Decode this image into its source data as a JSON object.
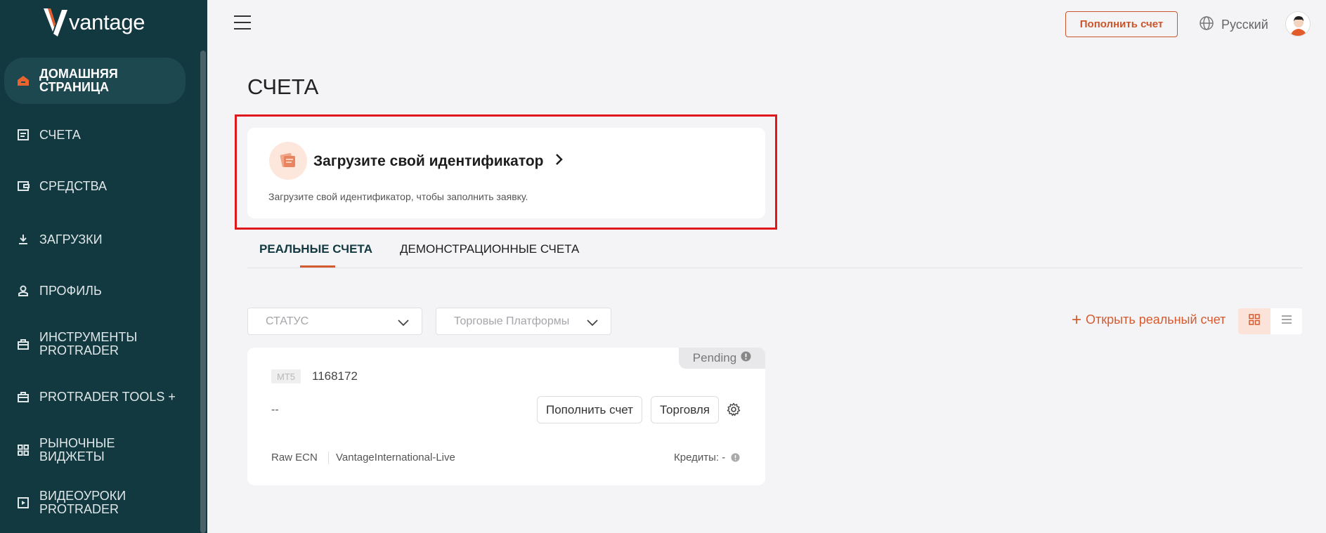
{
  "logo": {
    "text": "vantage"
  },
  "sidebar": {
    "items": [
      {
        "label": "ДОМАШНЯЯ СТРАНИЦА",
        "icon": "home-icon",
        "active": true
      },
      {
        "label": "СЧЕТА",
        "icon": "accounts-icon"
      },
      {
        "label": "СРЕДСТВА",
        "icon": "wallet-icon"
      },
      {
        "label": "ЗАГРУЗКИ",
        "icon": "download-icon"
      },
      {
        "label": "ПРОФИЛЬ",
        "icon": "user-icon"
      },
      {
        "label": "ИНСТРУМЕНТЫ PROTRADER",
        "icon": "toolbox-icon"
      },
      {
        "label": "PROTRADER TOOLS +",
        "icon": "toolbox-icon"
      },
      {
        "label": "РЫНОЧНЫЕ ВИДЖЕТЫ",
        "icon": "widgets-icon"
      },
      {
        "label": "ВИДЕОУРОКИ PROTRADER",
        "icon": "video-icon"
      }
    ]
  },
  "header": {
    "topup_label": "Пополнить счет",
    "language": "Русский",
    "icons": [
      "menu-icon",
      "globe-icon",
      "avatar"
    ]
  },
  "page": {
    "title": "СЧЕТА"
  },
  "id_card": {
    "title": "Загрузите свой идентификатор",
    "description": "Загрузите свой идентификатор, чтобы заполнить заявку."
  },
  "tabs": [
    {
      "label": "РЕАЛЬНЫЕ СЧЕТА",
      "active": true
    },
    {
      "label": "ДЕМОНСТРАЦИОННЫЕ СЧЕТА",
      "active": false
    }
  ],
  "filters": {
    "status_placeholder": "СТАТУС",
    "platform_placeholder": "Торговые Платформы"
  },
  "open_account_label": "Открыть реальный счет",
  "account": {
    "status": "Pending",
    "platform": "MT5",
    "number": "1168172",
    "balance": "--",
    "topup_label": "Пополнить счет",
    "trade_label": "Торговля",
    "type": "Raw ECN",
    "server": "VantageInternational-Live",
    "credits": "Кредиты: -"
  },
  "colors": {
    "sidebar": "#123840",
    "accent": "#d45b2f",
    "highlight": "#e0171d"
  }
}
